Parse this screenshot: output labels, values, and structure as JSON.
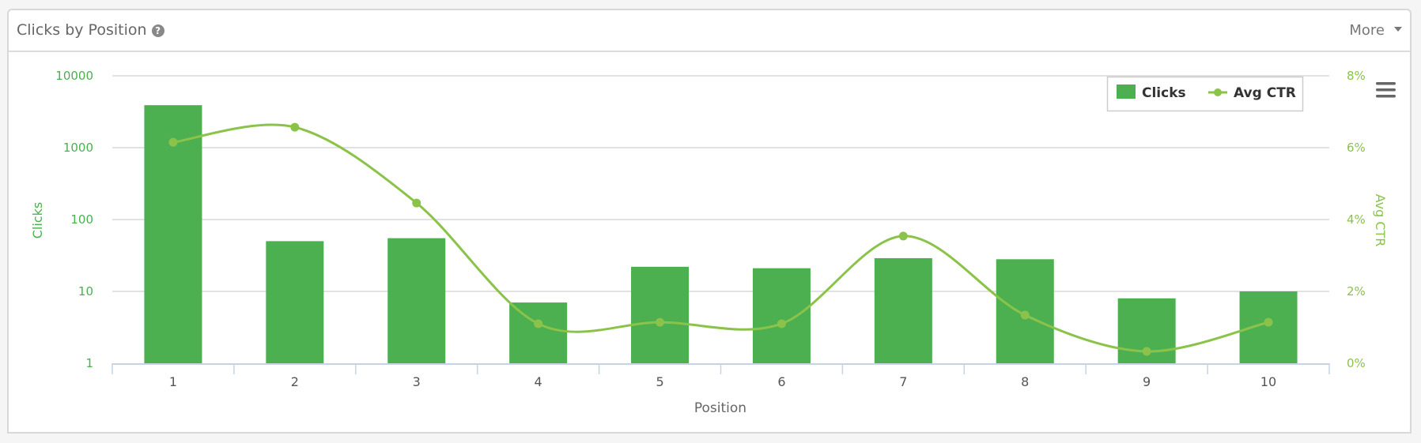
{
  "panel": {
    "title": "Clicks by Position",
    "help_icon": "question-circle-icon",
    "more_label": "More",
    "menu_icon": "hamburger-menu-icon"
  },
  "colors": {
    "clicks": "#4caf50",
    "avg_ctr": "#8bc34a"
  },
  "chart_data": {
    "type": "bar",
    "title": "Clicks by Position",
    "xlabel": "Position",
    "categories": [
      "1",
      "2",
      "3",
      "4",
      "5",
      "6",
      "7",
      "8",
      "9",
      "10"
    ],
    "series": [
      {
        "name": "Clicks",
        "type": "bar",
        "axis": "left",
        "values": [
          3900,
          50,
          55,
          7,
          22,
          21,
          29,
          28,
          8,
          10
        ]
      },
      {
        "name": "Avg CTR",
        "type": "line",
        "axis": "right",
        "smooth": true,
        "values": [
          6.15,
          6.57,
          4.46,
          1.1,
          1.14,
          1.1,
          3.54,
          1.34,
          0.33,
          1.14
        ]
      }
    ],
    "y_left": {
      "label": "Clicks",
      "scale": "log",
      "range": [
        1,
        10000
      ],
      "ticks": [
        1,
        10,
        100,
        1000,
        10000
      ],
      "tick_labels": [
        "1",
        "10",
        "100",
        "1000",
        "10000"
      ]
    },
    "y_right": {
      "label": "Avg CTR",
      "scale": "linear",
      "range": [
        0,
        8
      ],
      "ticks": [
        0,
        2,
        4,
        6,
        8
      ],
      "tick_labels": [
        "0%",
        "2%",
        "4%",
        "6%",
        "8%"
      ]
    },
    "grid": true,
    "legend": {
      "position": "top-right",
      "items": [
        "Clicks",
        "Avg CTR"
      ]
    }
  }
}
